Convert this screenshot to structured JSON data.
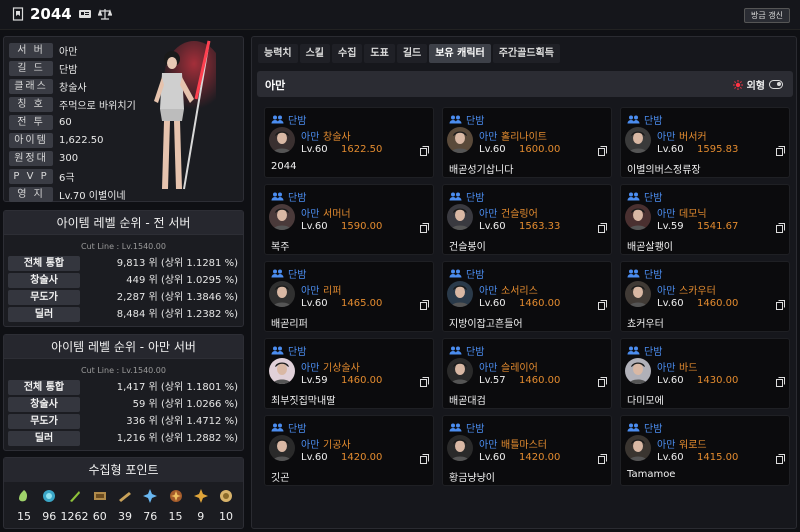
{
  "header": {
    "character_name": "2044",
    "refresh_label": "방금 갱신"
  },
  "profile": {
    "rows": [
      {
        "label": "서 버",
        "value": "아만"
      },
      {
        "label": "길 드",
        "value": "단밤"
      },
      {
        "label": "클래스",
        "value": "창술사"
      },
      {
        "label": "칭 호",
        "value": "주먹으로 바위치기"
      },
      {
        "label": "전 투",
        "value": "60"
      },
      {
        "label": "아이템",
        "value": "1,622.50"
      },
      {
        "label": "원정대",
        "value": "300"
      },
      {
        "label": "P V P",
        "value": "6극"
      },
      {
        "label": "영 지",
        "value": "Lv.70 이별이네"
      }
    ]
  },
  "rank_all": {
    "title": "아이템 레벨 순위 - 전 서버",
    "cutline": "Cut Line : Lv.1540.00",
    "rows": [
      {
        "label": "전체 통합",
        "value": "9,813 위 (상위   1.1281 %)"
      },
      {
        "label": "창술사",
        "value": "449 위 (상위   1.0295 %)"
      },
      {
        "label": "무도가",
        "value": "2,287 위 (상위   1.3846 %)"
      },
      {
        "label": "딜러",
        "value": "8,484 위 (상위   1.2382 %)"
      }
    ]
  },
  "rank_server": {
    "title": "아이템 레벨 순위 - 아만 서버",
    "cutline": "Cut Line : Lv.1540.00",
    "rows": [
      {
        "label": "전체 통합",
        "value": "1,417 위 (상위   1.1801 %)"
      },
      {
        "label": "창술사",
        "value": "59 위 (상위   1.0266 %)"
      },
      {
        "label": "무도가",
        "value": "336 위 (상위   1.4712 %)"
      },
      {
        "label": "딜러",
        "value": "1,216 위 (상위   1.2882 %)"
      }
    ]
  },
  "collect": {
    "title": "수집형 포인트",
    "items": [
      {
        "icon": "mokoko-seed-icon",
        "count": "15"
      },
      {
        "icon": "island-heart-icon",
        "count": "96"
      },
      {
        "icon": "giants-heart-icon",
        "count": "1262"
      },
      {
        "icon": "great-art-icon",
        "count": "60"
      },
      {
        "icon": "ignea-token-icon",
        "count": "39"
      },
      {
        "icon": "orpheus-star-icon",
        "count": "76"
      },
      {
        "icon": "omnium-star-icon",
        "count": "15"
      },
      {
        "icon": "world-tree-leaf-icon",
        "count": "9"
      },
      {
        "icon": "sea-bounty-icon",
        "count": "10"
      }
    ]
  },
  "tabs": [
    "능력치",
    "스킬",
    "수집",
    "도표",
    "길드",
    "보유 캐릭터",
    "주간골드획득"
  ],
  "active_tab": "보유 캐릭터",
  "roster": {
    "server": "아만",
    "toggle_label": "외형",
    "characters": [
      {
        "guild": "단밤",
        "server": "아만",
        "class": "창술사",
        "level": "Lv.60",
        "item_level": "1622.50",
        "name": "2044"
      },
      {
        "guild": "단밤",
        "server": "아만",
        "class": "홀리나이트",
        "level": "Lv.60",
        "item_level": "1600.00",
        "name": "배곧성기삽니다"
      },
      {
        "guild": "단밤",
        "server": "아만",
        "class": "버서커",
        "level": "Lv.60",
        "item_level": "1595.83",
        "name": "이별의버스정류장"
      },
      {
        "guild": "단밤",
        "server": "아만",
        "class": "서머너",
        "level": "Lv.60",
        "item_level": "1590.00",
        "name": "복주"
      },
      {
        "guild": "단밤",
        "server": "아만",
        "class": "건슬링어",
        "level": "Lv.60",
        "item_level": "1563.33",
        "name": "건슬봉이"
      },
      {
        "guild": "단밤",
        "server": "아만",
        "class": "데모닉",
        "level": "Lv.59",
        "item_level": "1541.67",
        "name": "배곧살쾡이"
      },
      {
        "guild": "단밤",
        "server": "아만",
        "class": "리퍼",
        "level": "Lv.60",
        "item_level": "1465.00",
        "name": "배곧리퍼"
      },
      {
        "guild": "단밤",
        "server": "아만",
        "class": "소서리스",
        "level": "Lv.60",
        "item_level": "1460.00",
        "name": "지방이잡고흔들어"
      },
      {
        "guild": "단밤",
        "server": "아만",
        "class": "스카우터",
        "level": "Lv.60",
        "item_level": "1460.00",
        "name": "쵸커우터"
      },
      {
        "guild": "단밤",
        "server": "아만",
        "class": "기상술사",
        "level": "Lv.59",
        "item_level": "1460.00",
        "name": "최부짓집막내딸"
      },
      {
        "guild": "단밤",
        "server": "아만",
        "class": "슬레이어",
        "level": "Lv.57",
        "item_level": "1460.00",
        "name": "배곧대검"
      },
      {
        "guild": "단밤",
        "server": "아만",
        "class": "바드",
        "level": "Lv.60",
        "item_level": "1430.00",
        "name": "다미모에"
      },
      {
        "guild": "단밤",
        "server": "아만",
        "class": "기공사",
        "level": "Lv.60",
        "item_level": "1420.00",
        "name": "깃곤"
      },
      {
        "guild": "단밤",
        "server": "아만",
        "class": "배틀마스터",
        "level": "Lv.60",
        "item_level": "1420.00",
        "name": "황금냥냥이"
      },
      {
        "guild": "단밤",
        "server": "아만",
        "class": "워로드",
        "level": "Lv.60",
        "item_level": "1415.00",
        "name": "Tamamoe"
      }
    ]
  },
  "colors": {
    "guild_blue": "#4b8df0",
    "class_orange": "#e38b2f",
    "panel": "#1b1c21"
  }
}
